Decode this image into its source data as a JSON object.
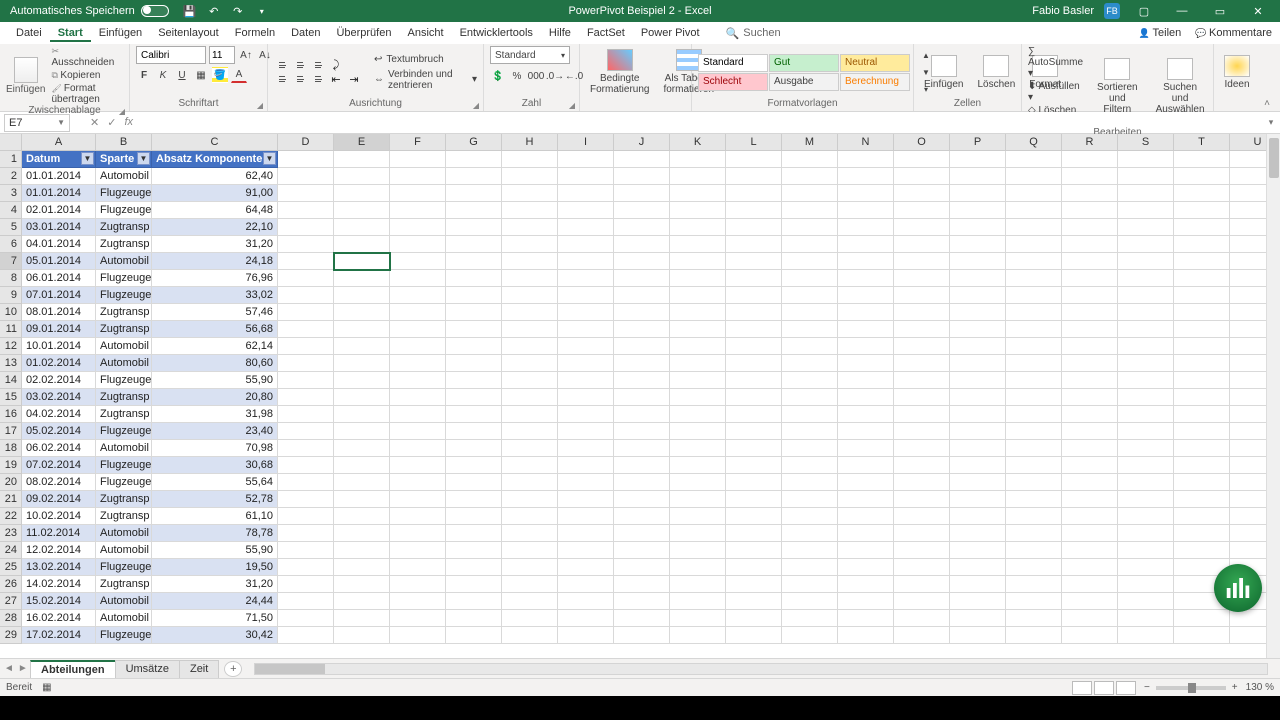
{
  "colors": {
    "accent": "#217346",
    "tableHeader": "#4472c4",
    "band": "#d9e1f2"
  },
  "titlebar": {
    "autosave_label": "Automatisches Speichern",
    "doc_title": "PowerPivot Beispiel 2 - Excel",
    "username": "Fabio Basler",
    "user_initials": "FB"
  },
  "menu": {
    "items": [
      "Datei",
      "Start",
      "Einfügen",
      "Seitenlayout",
      "Formeln",
      "Daten",
      "Überprüfen",
      "Ansicht",
      "Entwicklertools",
      "Hilfe",
      "FactSet",
      "Power Pivot"
    ],
    "search_placeholder": "Suchen",
    "share": "Teilen",
    "comments": "Kommentare"
  },
  "ribbon": {
    "clipboard": {
      "paste": "Einfügen",
      "cut": "Ausschneiden",
      "copy": "Kopieren",
      "painter": "Format übertragen",
      "group": "Zwischenablage"
    },
    "font": {
      "name": "Calibri",
      "size": "11",
      "group": "Schriftart"
    },
    "align": {
      "wrap": "Textumbruch",
      "merge": "Verbinden und zentrieren",
      "group": "Ausrichtung"
    },
    "number": {
      "format": "Standard",
      "group": "Zahl"
    },
    "cond": {
      "cond": "Bedingte Formatierung",
      "table": "Als Tabelle formatieren"
    },
    "styles": {
      "group": "Formatvorlagen",
      "cells": [
        {
          "t": "Standard",
          "bg": "#ffffff",
          "fg": "#000000"
        },
        {
          "t": "Gut",
          "bg": "#c6efce",
          "fg": "#006100"
        },
        {
          "t": "Neutral",
          "bg": "#ffeb9c",
          "fg": "#9c5700"
        },
        {
          "t": "Schlecht",
          "bg": "#ffc7ce",
          "fg": "#9c0006"
        },
        {
          "t": "Ausgabe",
          "bg": "#f2f2f2",
          "fg": "#3f3f3f"
        },
        {
          "t": "Berechnung",
          "bg": "#f2f2f2",
          "fg": "#fa7d00"
        }
      ]
    },
    "cells": {
      "insert": "Einfügen",
      "delete": "Löschen",
      "format": "Format",
      "group": "Zellen"
    },
    "edit": {
      "sum": "AutoSumme",
      "fill": "Ausfüllen",
      "clear": "Löschen",
      "sort": "Sortieren und Filtern",
      "find": "Suchen und Auswählen",
      "group": "Bearbeiten"
    },
    "ideas": {
      "label": "Ideen"
    }
  },
  "namebox": "E7",
  "columns": [
    "A",
    "B",
    "C",
    "D",
    "E",
    "F",
    "G",
    "H",
    "I",
    "J",
    "K",
    "L",
    "M",
    "N",
    "O",
    "P",
    "Q",
    "R",
    "S",
    "T",
    "U"
  ],
  "table": {
    "headers": [
      "Datum",
      "Sparte",
      "Absatz Komponenten"
    ],
    "rows": [
      [
        "01.01.2014",
        "Automobil",
        "62,40"
      ],
      [
        "01.01.2014",
        "Flugzeuge",
        "91,00"
      ],
      [
        "02.01.2014",
        "Flugzeuge",
        "64,48"
      ],
      [
        "03.01.2014",
        "Zugtransp",
        "22,10"
      ],
      [
        "04.01.2014",
        "Zugtransp",
        "31,20"
      ],
      [
        "05.01.2014",
        "Automobil",
        "24,18"
      ],
      [
        "06.01.2014",
        "Flugzeuge",
        "76,96"
      ],
      [
        "07.01.2014",
        "Flugzeuge",
        "33,02"
      ],
      [
        "08.01.2014",
        "Zugtransp",
        "57,46"
      ],
      [
        "09.01.2014",
        "Zugtransp",
        "56,68"
      ],
      [
        "10.01.2014",
        "Automobil",
        "62,14"
      ],
      [
        "01.02.2014",
        "Automobil",
        "80,60"
      ],
      [
        "02.02.2014",
        "Flugzeuge",
        "55,90"
      ],
      [
        "03.02.2014",
        "Zugtransp",
        "20,80"
      ],
      [
        "04.02.2014",
        "Zugtransp",
        "31,98"
      ],
      [
        "05.02.2014",
        "Flugzeuge",
        "23,40"
      ],
      [
        "06.02.2014",
        "Automobil",
        "70,98"
      ],
      [
        "07.02.2014",
        "Flugzeuge",
        "30,68"
      ],
      [
        "08.02.2014",
        "Flugzeuge",
        "55,64"
      ],
      [
        "09.02.2014",
        "Zugtransp",
        "52,78"
      ],
      [
        "10.02.2014",
        "Zugtransp",
        "61,10"
      ],
      [
        "11.02.2014",
        "Automobil",
        "78,78"
      ],
      [
        "12.02.2014",
        "Automobil",
        "55,90"
      ],
      [
        "13.02.2014",
        "Flugzeuge",
        "19,50"
      ],
      [
        "14.02.2014",
        "Zugtransp",
        "31,20"
      ],
      [
        "15.02.2014",
        "Automobil",
        "24,44"
      ],
      [
        "16.02.2014",
        "Automobil",
        "71,50"
      ],
      [
        "17.02.2014",
        "Flugzeuge",
        "30,42"
      ]
    ]
  },
  "sheets": {
    "tabs": [
      "Abteilungen",
      "Umsätze",
      "Zeit"
    ],
    "active": 0
  },
  "status": {
    "ready": "Bereit",
    "zoom": "130 %"
  },
  "selection": {
    "col_index": 4,
    "row_number": 7
  }
}
